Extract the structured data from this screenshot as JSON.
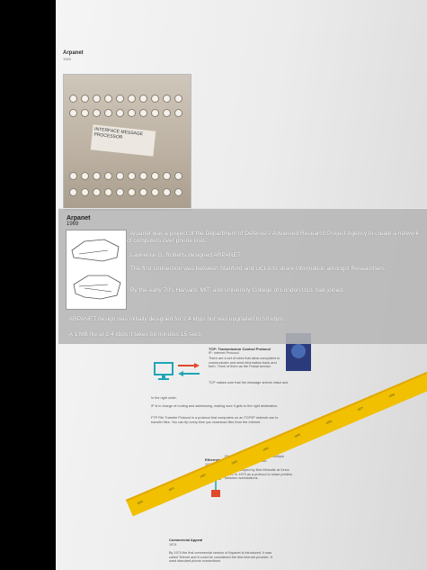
{
  "header": {
    "title": "Arpanet",
    "year": "1969"
  },
  "photo": {
    "caption_text": "INTERFACE MESSAGE PROCESSOR"
  },
  "overlay": {
    "title": "Arpanet",
    "year": "1969",
    "bullets": [
      "· Arpanet was a project of the Department of Defense's Advanced Research Project Agency to create a network of computers over phone lines.",
      "· Lawrence G. Roberts designed ARPANET",
      "· The first connection was between Stanford and UCLA to share information amongst Researchers.",
      "· By the early 70's Harvard, MIT, and University College of London UCL had joined.",
      "· ARPANET design was initially designed for 2.4 kbps but was upgraded to 50 kbps.",
      "· A 1 MB file at 2.4 kbps it takes 58 minutes 15 secs"
    ]
  },
  "background": {
    "tcp_title": "TCP: Transmission Control Protocol",
    "tcp_sub": "IP: Internet Protocol",
    "tcp_desc": "There are a set of rules that allow computers to communicate and send information back and forth. Think of them as the Postal service.",
    "tcp_note": "TCP makes sure that the message arrives intact and",
    "in_order": "In the right order.",
    "ip_note": "IP is in charge of routing and addressing, making sure it gets to the right destination.",
    "ftp_note": "FTP File Transfer Protocol is a protocol that computers on an TCP/IP network use to transfer files. You can ftp every time you download files from the Internet.",
    "ethernet_title": "Ethernet",
    "ethernet_year": "1973",
    "ethernet_desc": "Ethernet is a way to connect to multiple computers inside a network.",
    "ethernet_note": "It was developed by Bob Metcalfe at Xerox PARC in 1973 as a protocol to share printers between workstations.",
    "commercial_title": "Commercial Appeal",
    "commercial_year": "1974",
    "commercial_desc": "By 1974 the first commercial version of Arpanet is introduced. It was called Telenet and it could be considered the first Internet provider. It used standard phone connections.",
    "years": [
      "1970",
      "1971",
      "1972",
      "1973",
      "1974",
      "1975",
      "1976",
      "1977",
      "1978",
      "1979",
      "1980"
    ]
  },
  "colors": {
    "timeline": "#f1c000",
    "teal": "#20a5b6",
    "red": "#e04a2b"
  }
}
